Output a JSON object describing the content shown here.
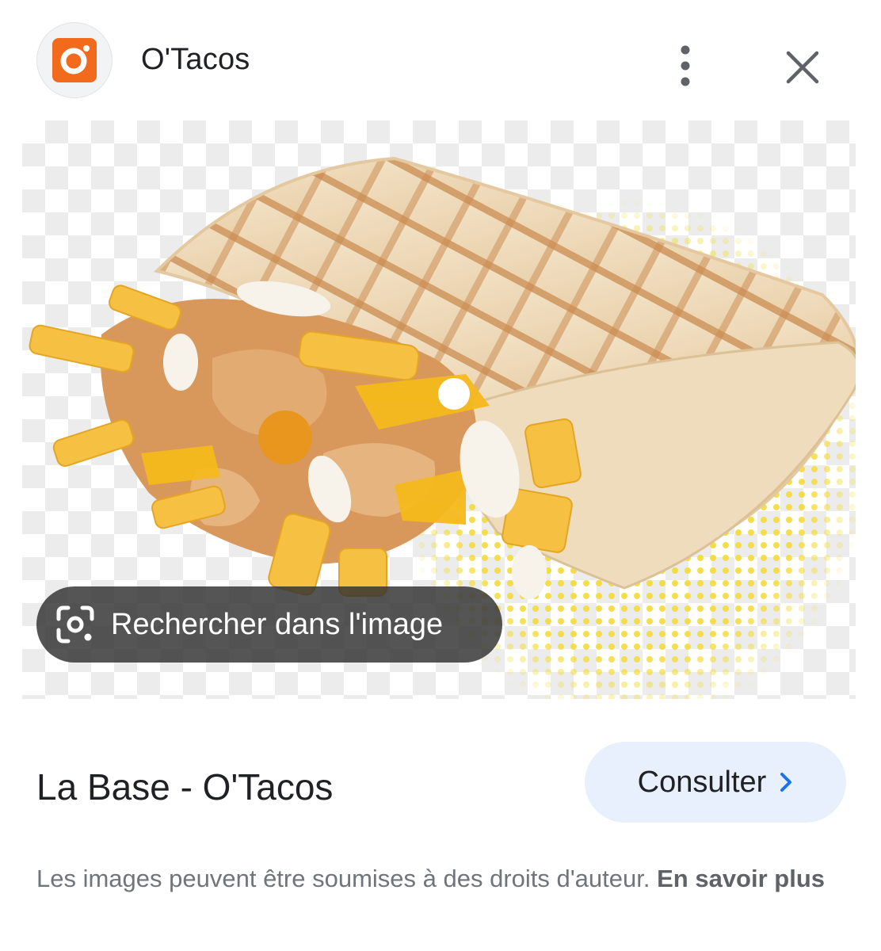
{
  "header": {
    "site_name": "O'Tacos",
    "logo_icon": "otacos-logo-icon",
    "more_icon": "more-vertical-icon",
    "close_icon": "close-icon"
  },
  "image": {
    "subject": "tacos-wrap-photo",
    "search_in_image_label": "Rechercher dans l'image",
    "search_icon": "google-lens-icon"
  },
  "result": {
    "title": "La Base - O'Tacos",
    "visit_label": "Consulter",
    "visit_icon": "chevron-right-icon"
  },
  "footer": {
    "notice_text": "Les images peuvent être soumises à des droits d'auteur.",
    "learn_more_label": "En savoir plus"
  },
  "colors": {
    "brand_orange": "#f26a1b",
    "button_bg": "#e8f0fe",
    "link_blue": "#1a73e8"
  }
}
